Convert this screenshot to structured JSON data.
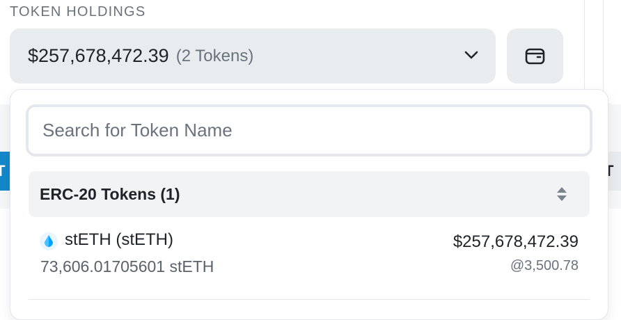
{
  "token_holdings": {
    "label": "TOKEN HOLDINGS",
    "total_value": "$257,678,472.39",
    "token_count": "(2 Tokens)",
    "chevron_icon": "chevron-down-icon",
    "wallet_icon": "wallet-icon"
  },
  "dropdown": {
    "search": {
      "placeholder": "Search for Token Name",
      "value": ""
    },
    "groups": [
      {
        "title": "ERC-20 Tokens (1)",
        "sort_icon": "sort-icon",
        "tokens": [
          {
            "name": "stETH (stETH)",
            "icon": "steth-icon",
            "quantity": "73,606.01705601 stETH",
            "value": "$257,678,472.39",
            "rate": "@3,500.78"
          }
        ]
      }
    ]
  },
  "background": {
    "left_tab_text": "T",
    "right_tab_text": "T T"
  },
  "colors": {
    "accent_blue": "#1488cc",
    "control_bg": "#e9ecef",
    "steth_blue": "#00a3ff"
  }
}
